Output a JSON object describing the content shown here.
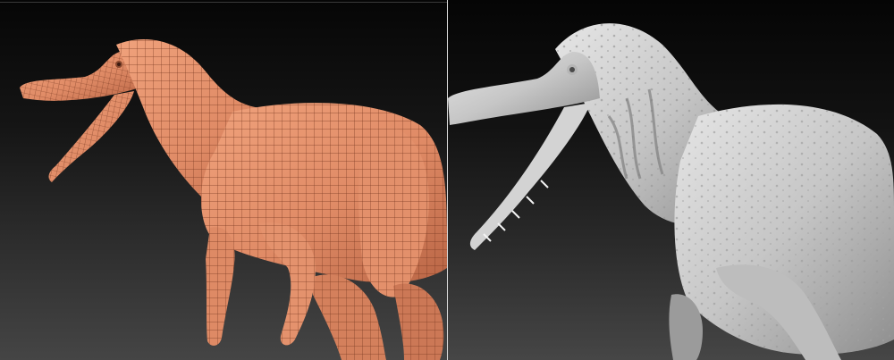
{
  "image": {
    "panels": [
      {
        "id": "wireframe",
        "subject_icon": "spinosaurus-wireframe-render",
        "surface_color": "#e49570",
        "wire_color": "#7a3a22",
        "background_top": "#060606",
        "background_bottom": "#454545"
      },
      {
        "id": "sculpt",
        "subject_icon": "spinosaurus-sculpt-render",
        "surface_color": "#cfcfcf",
        "detail_color": "#8a8a8a",
        "background_top": "#050505",
        "background_bottom": "#464646"
      }
    ],
    "divider_color": "#d8d8d8"
  }
}
